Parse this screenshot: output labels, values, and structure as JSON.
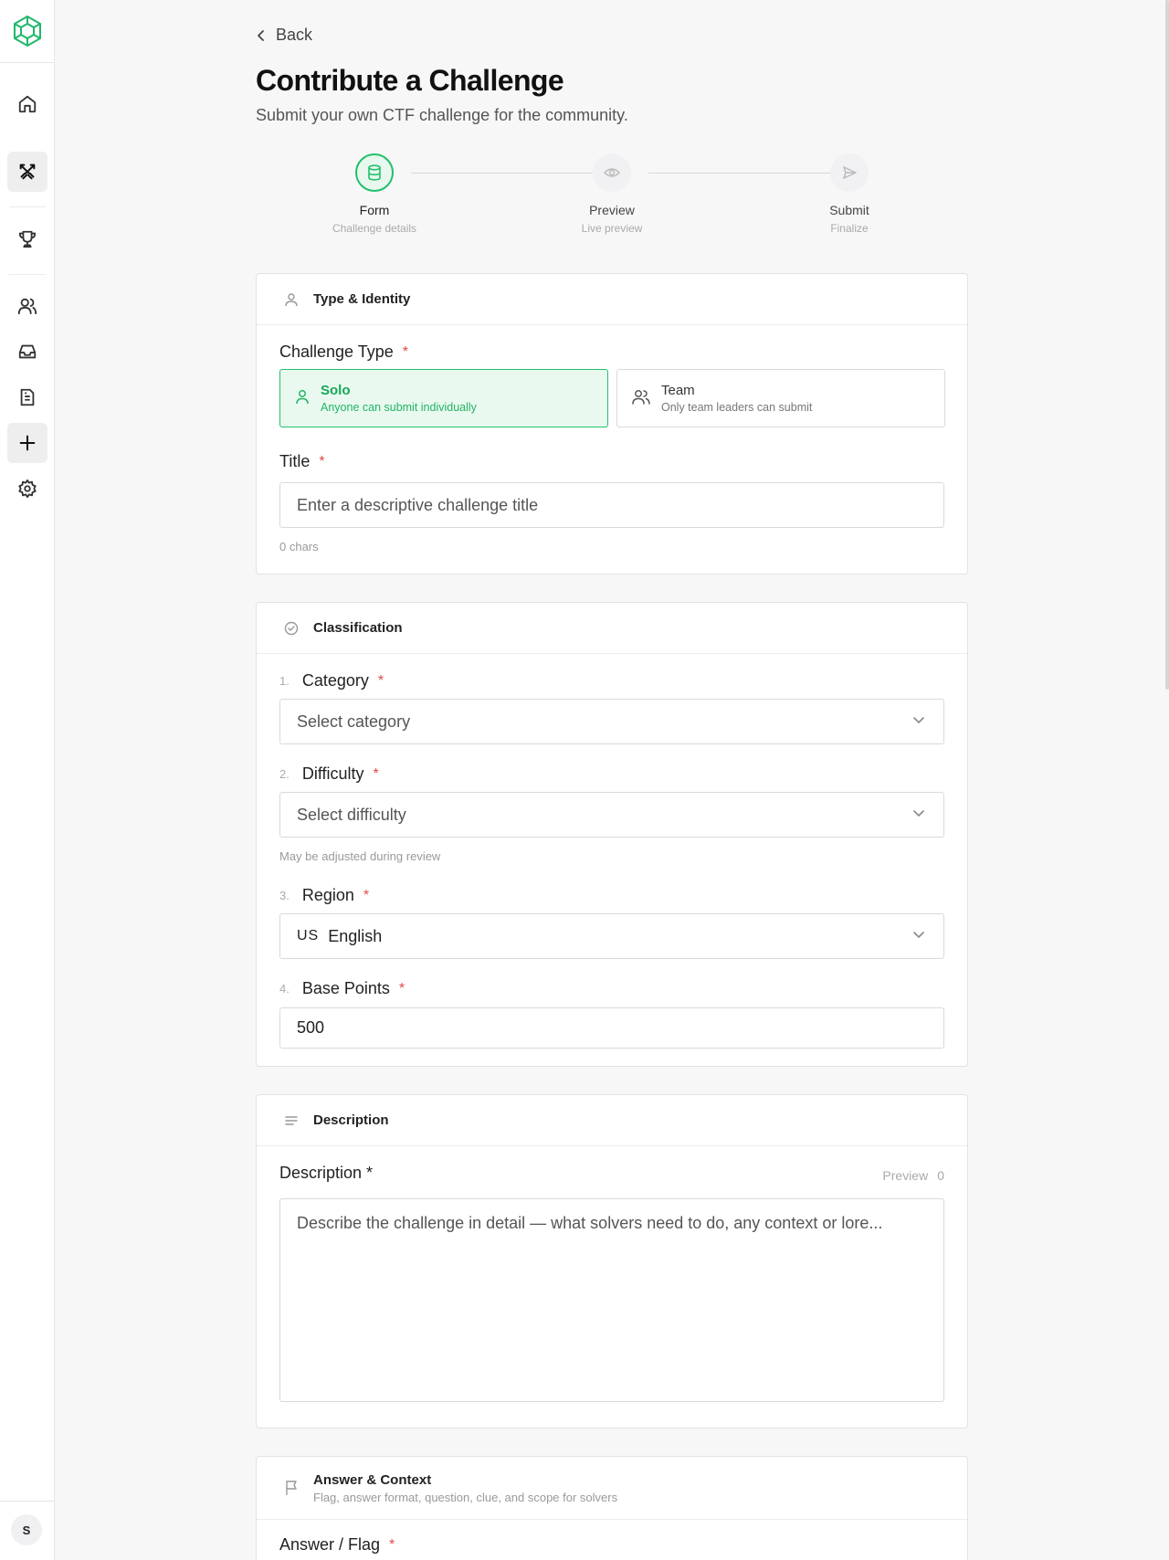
{
  "sidebar": {
    "avatar_initial": "S",
    "items": [
      {
        "icon": "home-icon"
      },
      {
        "icon": "swords-icon",
        "active": true
      },
      {
        "icon": "trophy-icon"
      },
      {
        "icon": "users-icon"
      },
      {
        "icon": "inbox-icon"
      },
      {
        "icon": "document-icon"
      },
      {
        "icon": "plus-icon",
        "active": true
      },
      {
        "icon": "gear-icon"
      }
    ]
  },
  "header": {
    "back_label": "Back",
    "title": "Contribute a Challenge",
    "subtitle": "Submit your own CTF challenge for the community."
  },
  "stepper": {
    "steps": [
      {
        "label": "Form",
        "sub": "Challenge details",
        "active": true
      },
      {
        "label": "Preview",
        "sub": "Live preview",
        "active": false
      },
      {
        "label": "Submit",
        "sub": "Finalize",
        "active": false
      }
    ]
  },
  "type_identity": {
    "section_title": "Type & Identity",
    "challenge_type_label": "Challenge Type",
    "required_mark": "*",
    "options": [
      {
        "title": "Solo",
        "sub": "Anyone can submit individually",
        "selected": true
      },
      {
        "title": "Team",
        "sub": "Only team leaders can submit",
        "selected": false
      }
    ],
    "title_label": "Title",
    "title_placeholder": "Enter a descriptive challenge title",
    "char_count": "0 chars"
  },
  "classification": {
    "section_title": "Classification",
    "category": {
      "num": "1.",
      "label": "Category",
      "placeholder": "Select category"
    },
    "difficulty": {
      "num": "2.",
      "label": "Difficulty",
      "placeholder": "Select difficulty",
      "hint": "May be adjusted during review"
    },
    "region": {
      "num": "3.",
      "label": "Region",
      "flag": "US",
      "value": "English"
    },
    "base_points": {
      "num": "4.",
      "label": "Base Points",
      "value": "500"
    }
  },
  "description": {
    "section_title": "Description",
    "label": "Description *",
    "preview_label": "Preview",
    "count": "0",
    "placeholder": "Describe the challenge in detail — what solvers need to do, any context or lore..."
  },
  "answer_context": {
    "section_title": "Answer & Context",
    "section_sub": "Flag, answer format, question, clue, and scope for solvers",
    "answer_label": "Answer / Flag"
  },
  "colors": {
    "accent": "#22c06a",
    "accent_bg": "#e9f9ef",
    "required": "#e04a4a"
  }
}
